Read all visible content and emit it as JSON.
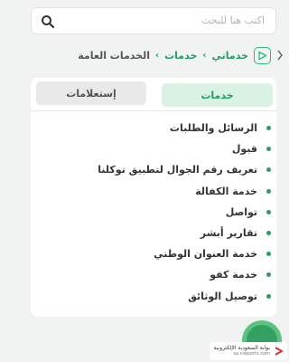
{
  "search": {
    "placeholder": "اكتب هنا للبحث"
  },
  "breadcrumb": {
    "home_icon": "play-shield-icon",
    "items": [
      "خدماتي",
      "خدمات",
      "الخدمات العامة"
    ],
    "separator": "›"
  },
  "tabs": [
    {
      "label": "خدمات",
      "active": true
    },
    {
      "label": "إستعلامات",
      "active": false
    }
  ],
  "services": [
    "الرسائل والطلبات",
    "قبول",
    "تعريف رقم الجوال لتطبيق توكلنا",
    "خدمة الكفالة",
    "تواصل",
    "تقارير أبشر",
    "خدمة العنوان الوطني",
    "خدمة كفو",
    "توصيل الوثائق"
  ],
  "watermark": {
    "title": "بوابة السعودية الإلكترونية",
    "url": "sa.ciwports.com"
  },
  "colors": {
    "accent": "#1f9f60",
    "active_tab_bg": "#d9f2e4",
    "inactive_tab_bg": "#e9e9e9",
    "bullet": "#2a9d5f"
  }
}
